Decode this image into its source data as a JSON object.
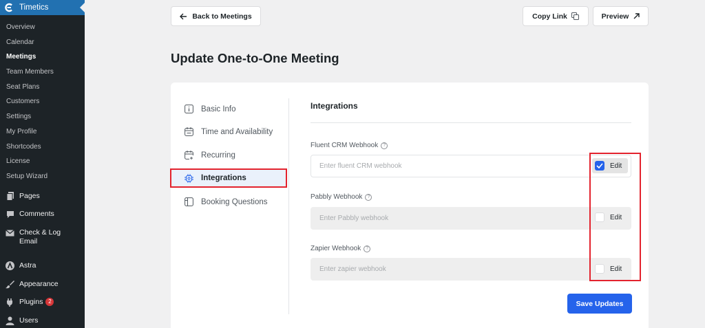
{
  "sidebar": {
    "brand": "Timetics",
    "submenu": [
      "Overview",
      "Calendar",
      "Meetings",
      "Team Members",
      "Seat Plans",
      "Customers",
      "Settings",
      "My Profile",
      "Shortcodes",
      "License",
      "Setup Wizard"
    ],
    "active_submenu": "Meetings",
    "menu": {
      "pages": "Pages",
      "comments": "Comments",
      "check_log_email": "Check & Log Email",
      "astra": "Astra",
      "appearance": "Appearance",
      "plugins": "Plugins",
      "plugins_badge": "2",
      "users": "Users"
    }
  },
  "header": {
    "back_label": "Back to Meetings",
    "copy_link_label": "Copy Link",
    "preview_label": "Preview"
  },
  "page": {
    "title": "Update One-to-One Meeting"
  },
  "tabs": {
    "basic_info": "Basic Info",
    "time_availability": "Time and Availability",
    "recurring": "Recurring",
    "integrations": "Integrations",
    "booking_questions": "Booking Questions",
    "active": "Integrations"
  },
  "integrations": {
    "title": "Integrations",
    "fluent": {
      "label": "Fluent CRM Webhook",
      "placeholder": "Enter fluent CRM webhook",
      "edit_label": "Edit",
      "checked": true
    },
    "pabbly": {
      "label": "Pabbly Webhook",
      "placeholder": "Enter Pabbly webhook",
      "edit_label": "Edit",
      "checked": false
    },
    "zapier": {
      "label": "Zapier Webhook",
      "placeholder": "Enter zapier webhook",
      "edit_label": "Edit",
      "checked": false
    },
    "save_label": "Save Updates"
  },
  "colors": {
    "accent": "#2563eb",
    "highlight": "#e3222d",
    "sidebar_bg": "#1d2327",
    "brand_bg": "#2271b1"
  }
}
